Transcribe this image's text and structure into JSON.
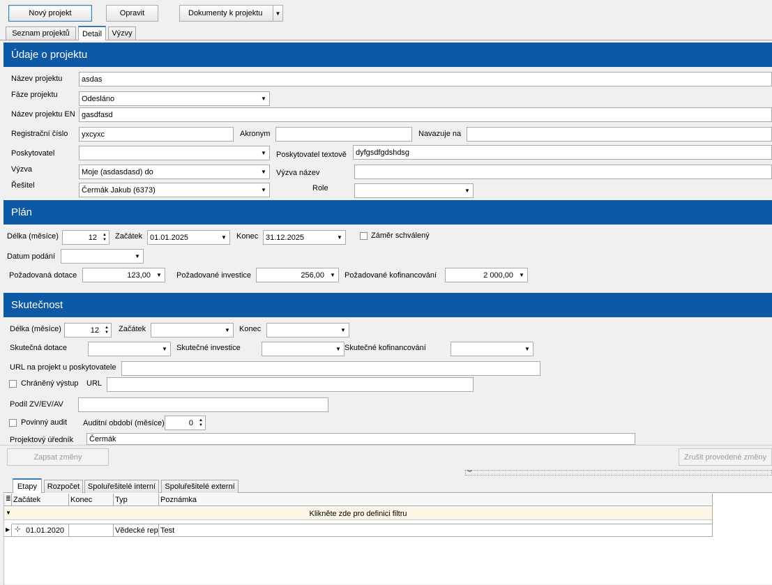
{
  "toolbar": {
    "new_project": "Nový projekt",
    "edit": "Opravit",
    "documents": "Dokumenty k projektu"
  },
  "tabs": {
    "list": "Seznam projektů",
    "detail": "Detail",
    "calls": "Výzvy"
  },
  "project": {
    "header": "Údaje o projektu",
    "name_label": "Název projektu",
    "name_value": "asdas",
    "phase_label": "Fáze projektu",
    "phase_value": "Odesláno",
    "name_en_label": "Název projektu EN",
    "name_en_value": "gasdfasd",
    "reg_label": "Registrační číslo",
    "reg_value": "yxcyxc",
    "acronym_label": "Akronym",
    "acronym_value": "",
    "follows_label": "Navazuje na",
    "follows_value": "",
    "provider_label": "Poskytovatel",
    "provider_value": "",
    "provider_text_label": "Poskytovatel textově",
    "provider_text_value": "dyfgsdfgdshdsg",
    "call_label": "Výzva",
    "call_value": "Moje (asdasdasd) do",
    "call_name_label": "Výzva název",
    "call_name_value": "",
    "solver_label": "Řešitel",
    "solver_value": "Čermák Jakub (6373)",
    "role_label": "Role",
    "role_value": ""
  },
  "plan": {
    "header": "Plán",
    "length_label": "Délka (měsíce)",
    "length_value": "12",
    "start_label": "Začátek",
    "start_value": "01.01.2025",
    "end_label": "Konec",
    "end_value": "31.12.2025",
    "approved_label": "Záměr schválený",
    "submit_label": "Datum podání",
    "submit_value": "",
    "subsidy_label": "Požadovaná dotace",
    "subsidy_value": "123,00",
    "investment_label": "Požadované investice",
    "investment_value": "256,00",
    "cofinancing_label": "Požadované kofinancování",
    "cofinancing_value": "2 000,00"
  },
  "actual": {
    "header": "Skutečnost",
    "length_label": "Délka (měsíce)",
    "length_value": "12",
    "start_label": "Začátek",
    "start_value": "",
    "end_label": "Konec",
    "end_value": "",
    "subsidy_label": "Skutečná dotace",
    "investment_label": "Skutečné investice",
    "cofinancing_label": "Skutečné kofinancování",
    "url_provider_label": "URL na projekt u poskytovatele",
    "url_provider_value": "",
    "protected_label": "Chráněný výstup",
    "url_label": "URL",
    "url_value": "",
    "share_label": "Podíl ZV/EV/AV",
    "share_value": "",
    "audit_label": "Povinný audit",
    "audit_period_label": "Auditní období (měsíce)",
    "audit_period_value": "0",
    "officer_label": "Projektový úředník",
    "officer_value": "Čermák"
  },
  "actions": {
    "save": "Zapsat změny",
    "cancel": "Zrušit provedené změny"
  },
  "bottom_tabs": {
    "stages": "Etapy",
    "budget": "Rozpočet",
    "internal": "Spoluřešitelé interní",
    "external": "Spoluřešitelé externí"
  },
  "grid": {
    "columns": [
      "Začátek",
      "Konec",
      "Typ",
      "Poznámka"
    ],
    "filter_hint": "Klikněte zde pro definici filtru",
    "rows": [
      {
        "start": "01.01.2020",
        "end": "",
        "type": "Vědecké rep",
        "note": "Test"
      }
    ]
  }
}
